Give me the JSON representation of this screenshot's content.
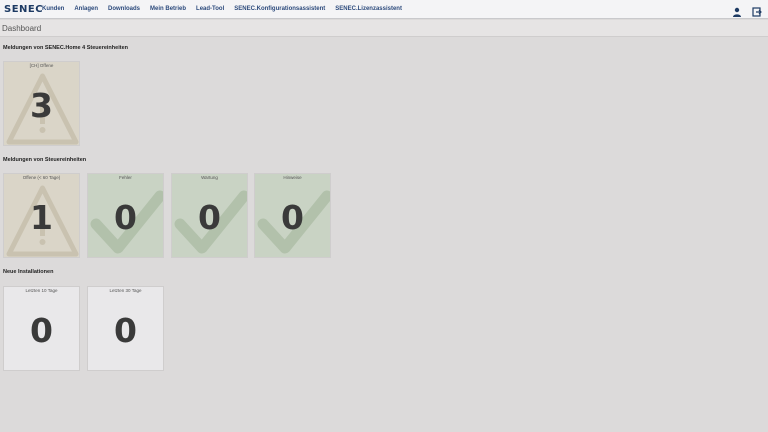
{
  "navbar": {
    "logo": "SENEC",
    "items": [
      "Kunden",
      "Anlagen",
      "Downloads",
      "Mein Betrieb",
      "Lead-Tool",
      "SENEC.Konfigurationsassistent",
      "SENEC.Lizenzassistent"
    ],
    "icons": [
      "user-icon",
      "logout-icon"
    ]
  },
  "page": {
    "title": "Dashboard"
  },
  "sections": [
    {
      "title": "Meldungen von SENEC.Home 4 Steuereinheiten",
      "tiles": [
        {
          "label": "[CH] Offene",
          "value": "3",
          "status": "warning"
        }
      ]
    },
    {
      "title": "Meldungen von Steuereinheiten",
      "tiles": [
        {
          "label": "Offene (< 60 Tage)",
          "value": "1",
          "status": "warning"
        },
        {
          "label": "Fehler",
          "value": "0",
          "status": "ok"
        },
        {
          "label": "Wartung",
          "value": "0",
          "status": "ok"
        },
        {
          "label": "Hinweise",
          "value": "0",
          "status": "ok"
        }
      ]
    },
    {
      "title": "Neue Installationen",
      "tiles": [
        {
          "label": "Letzten 10 Tage",
          "value": "0",
          "status": "neutral"
        },
        {
          "label": "Letzten 30 Tage",
          "value": "0",
          "status": "neutral"
        }
      ]
    }
  ],
  "colors": {
    "warning_tile": "#dad5c8",
    "ok_tile": "#c9d3c4",
    "neutral_tile": "#e9e8ea",
    "nav_text": "#2c4a7c"
  }
}
